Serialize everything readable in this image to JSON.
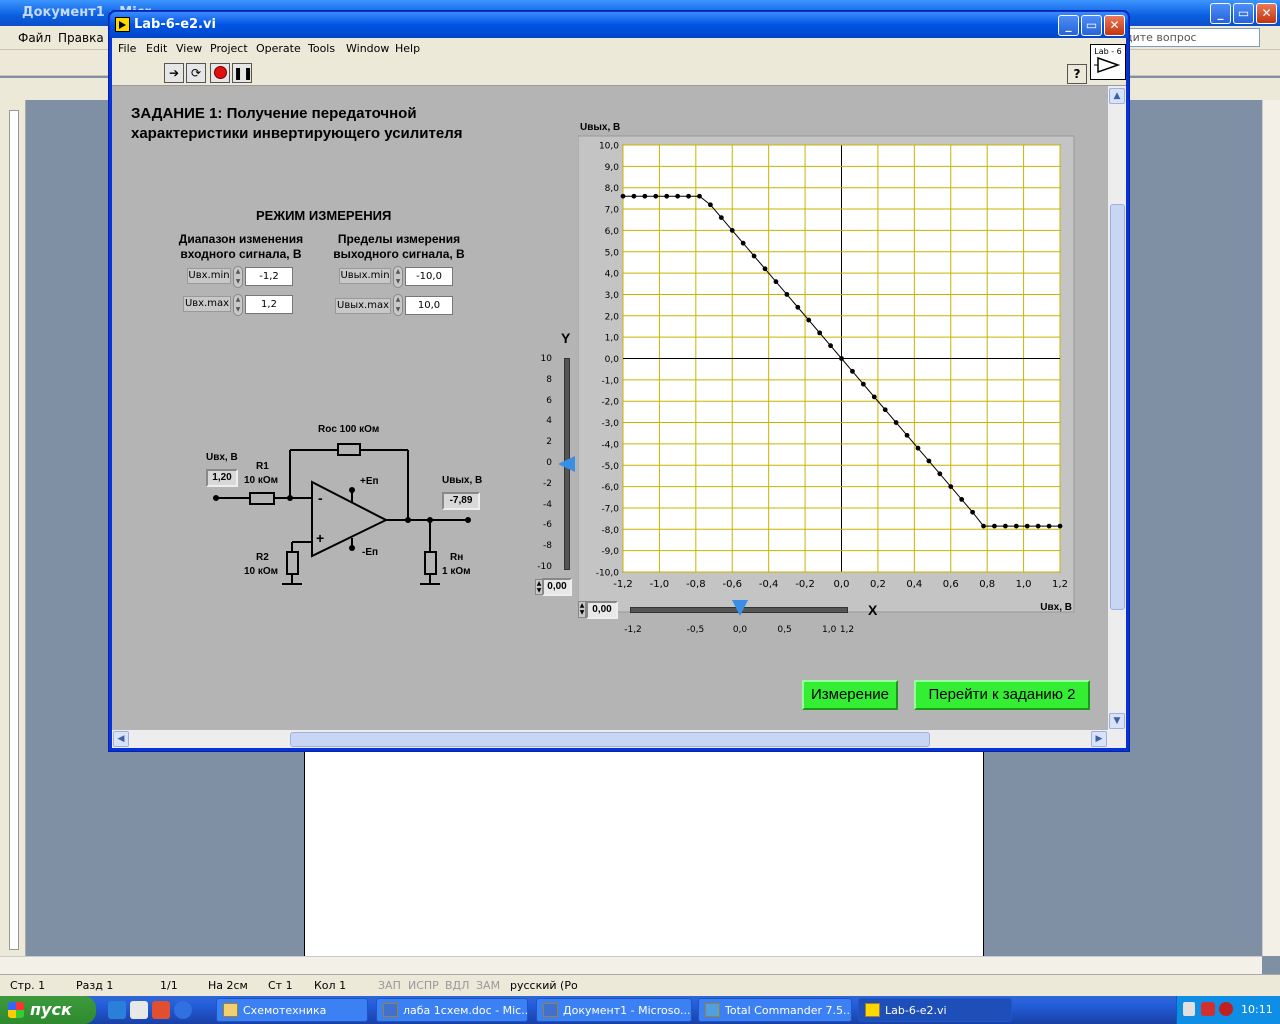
{
  "word": {
    "title": "Документ1 - Micr",
    "menu": [
      "Файл",
      "Правка"
    ],
    "ask_placeholder": "дите вопрос",
    "status": {
      "page": "Стр. 1",
      "section": "Разд 1",
      "pages": "1/1",
      "at": "На 2см",
      "line": "Ст 1",
      "col": "Кол 1",
      "rec": "ЗАП",
      "trk": "ИСПР",
      "ext": "ВДЛ",
      "ovr": "ЗАМ",
      "lang": "русский (Ро"
    }
  },
  "taskbar": {
    "start_label": "пуск",
    "tasks": [
      "Схемотехника",
      "лаба 1схем.doc - Mic...",
      "Документ1 - Microso...",
      "Total Commander 7.5...",
      "Lab-6-e2.vi"
    ],
    "clock": "10:11"
  },
  "labview": {
    "window_title": "Lab-6-e2.vi",
    "menu": [
      "File",
      "Edit",
      "View",
      "Project",
      "Operate",
      "Tools",
      "Window",
      "Help"
    ],
    "logo_text": "Lab - 6",
    "help_label": "?",
    "task_title_line1": "ЗАДАНИЕ 1: Получение передаточной",
    "task_title_line2": "характеристики инвертирующего усилителя",
    "mode_title": "РЕЖИМ ИЗМЕРЕНИЯ",
    "input_range_title": "Диапазон изменения входного сигнала, В",
    "output_range_title": "Пределы измерения выходного сигнала, В",
    "controls": {
      "uin_min_label": "Uвх.min",
      "uin_min_value": "-1,2",
      "uin_max_label": "Uвх.max",
      "uin_max_value": "1,2",
      "uout_min_label": "Uвых.min",
      "uout_min_value": "-10,0",
      "uout_max_label": "Uвых.max",
      "uout_max_value": "10,0"
    },
    "circuit": {
      "uin_label": "Uвх, В",
      "uin_value": "1,20",
      "r1_name": "R1",
      "r1_value": "10 кОм",
      "roc_label": "Roc 100 кОм",
      "vplus_label": "+Eп",
      "vminus_label": "-Eп",
      "minus_sign": "-",
      "plus_sign": "+",
      "uout_label": "Uвых, В",
      "uout_value": "-7,89",
      "r2_name": "R2",
      "r2_value": "10 кОм",
      "rn_name": "Rн",
      "rn_value": "1 кОм"
    },
    "y_slider": {
      "label": "Y",
      "ticks": [
        "10",
        "8",
        "6",
        "4",
        "2",
        "0",
        "-2",
        "-4",
        "-6",
        "-8",
        "-10"
      ],
      "value": "0,00",
      "level": 0
    },
    "x_slider": {
      "label": "X",
      "ticks": [
        "-1,2",
        "-0,5",
        "0,0",
        "0,5",
        "1,0",
        "1,2"
      ],
      "value": "0,00",
      "level": 0
    },
    "buttons": {
      "measure": "Измерение",
      "next_task": "Перейти к заданию 2"
    },
    "colors": {
      "panel": "#b4b4b4",
      "plot_bg": "#ffffff",
      "grid": "#c8b400",
      "button_green": "#33ee33"
    }
  },
  "chart_data": {
    "type": "line",
    "xlabel": "Uвх, В",
    "ylabel": "Uвых, В",
    "xlim": [
      -1.2,
      1.2
    ],
    "ylim": [
      -10,
      10
    ],
    "grid": true,
    "x_ticks": [
      "-1,2",
      "-1,0",
      "-0,8",
      "-0,6",
      "-0,4",
      "-0,2",
      "0,0",
      "0,2",
      "0,4",
      "0,6",
      "0,8",
      "1,0",
      "1,2"
    ],
    "y_ticks": [
      "10,0",
      "9,0",
      "8,0",
      "7,0",
      "6,0",
      "5,0",
      "4,0",
      "3,0",
      "2,0",
      "1,0",
      "0,0",
      "-1,0",
      "-2,0",
      "-3,0",
      "-4,0",
      "-5,0",
      "-6,0",
      "-7,0",
      "-8,0",
      "-9,0",
      "-10,0"
    ],
    "series": [
      {
        "x": [
          -1.2,
          -1.14,
          -1.08,
          -1.02,
          -0.96,
          -0.9,
          -0.84,
          -0.78,
          -0.72,
          -0.66,
          -0.6,
          -0.54,
          -0.48,
          -0.42,
          -0.36,
          -0.3,
          -0.24,
          -0.18,
          -0.12,
          -0.06,
          0.0,
          0.06,
          0.12,
          0.18,
          0.24,
          0.3,
          0.36,
          0.42,
          0.48,
          0.54,
          0.6,
          0.66,
          0.72,
          0.78,
          0.84,
          0.9,
          0.96,
          1.02,
          1.08,
          1.14,
          1.2
        ],
        "y": [
          7.6,
          7.6,
          7.6,
          7.6,
          7.6,
          7.6,
          7.6,
          7.6,
          7.2,
          6.6,
          6.0,
          5.4,
          4.8,
          4.2,
          3.6,
          3.0,
          2.4,
          1.8,
          1.2,
          0.6,
          0.0,
          -0.6,
          -1.2,
          -1.8,
          -2.4,
          -3.0,
          -3.6,
          -4.2,
          -4.8,
          -5.4,
          -6.0,
          -6.6,
          -7.2,
          -7.85,
          -7.85,
          -7.85,
          -7.85,
          -7.85,
          -7.85,
          -7.85,
          -7.85
        ]
      }
    ]
  }
}
